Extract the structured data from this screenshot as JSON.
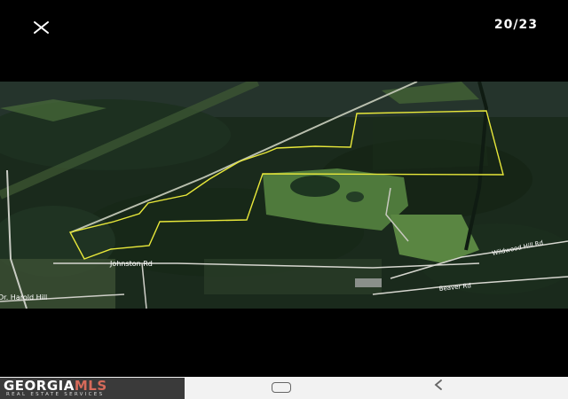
{
  "viewer": {
    "counter": "20/23",
    "close_icon": "close-icon",
    "back_icon": "chevron-left-icon",
    "home_icon": "home-rounded-rect-icon"
  },
  "photo": {
    "road_labels": {
      "johnston": "Johnston Rd",
      "left_bottom": "Dr. Harold Hill",
      "right_upper": "Wildwood Hill Rd",
      "right_lower": "Beaver Rd"
    },
    "boundary_color": "#e8e83a"
  },
  "watermark": {
    "brand_prefix": "GEORGIA",
    "brand_suffix": "MLS",
    "tagline": "REAL ESTATE SERVICES",
    "accent_color": "#d66a5a"
  }
}
